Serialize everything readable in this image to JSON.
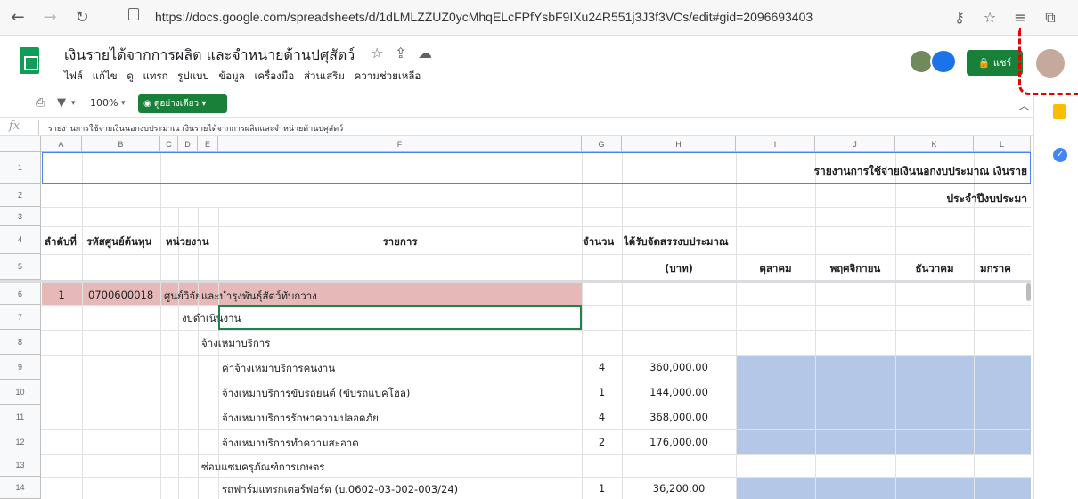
{
  "browser": {
    "url": "https://docs.google.com/spreadsheets/d/1dLMLZZUZ0ycMhqELcFPfYsbF9IXu24R551j3J3f3VCs/edit#gid=2096693403",
    "back_icon": "←",
    "forward_icon": "→",
    "reload_icon": "↻",
    "lock_icon": "🔒"
  },
  "doc": {
    "title": "เงินรายได้จากการผลิต และจำหน่ายด้านปศุสัตว์",
    "menu": [
      "ไฟล์",
      "แก้ไข",
      "ดู",
      "แทรก",
      "รูปแบบ",
      "ข้อมูล",
      "เครื่องมือ",
      "ส่วนเสริม",
      "ความช่วยเหลือ"
    ],
    "share_label": "แชร์"
  },
  "toolbar": {
    "zoom": "100%",
    "view_mode": "ดูอย่างเดียว"
  },
  "formula_bar": {
    "fx": "fx",
    "content": "รายงานการใช้จ่ายเงินนอกงบประมาณ เงินรายได้จากการผลิตและจำหน่ายด้านปศุสัตว์"
  },
  "columns": [
    "A",
    "B",
    "C",
    "D",
    "E",
    "F",
    "G",
    "H",
    "I",
    "J",
    "K",
    "L"
  ],
  "rows": [
    "1",
    "2",
    "3",
    "4",
    "5",
    "6",
    "7",
    "8",
    "9",
    "10",
    "11",
    "12",
    "13",
    "14"
  ],
  "sheet": {
    "r1_title": "รายงานการใช้จ่ายเงินนอกงบประมาณ เงินราย",
    "r2_subtitle": "ประจำปีงบประมา",
    "h_seq": "ลำดับที่",
    "h_cost_center": "รหัสศูนย์ต้นทุน",
    "h_unit": "หน่วยงาน",
    "h_item": "รายการ",
    "h_qty": "จำนวน",
    "h_budget": "ได้รับจัดสรรงบประมาณ",
    "h_baht": "(บาท)",
    "h_oct": "ตุลาคม",
    "h_nov": "พฤศจิกายน",
    "h_dec": "ธันวาคม",
    "h_jan": "มกราค",
    "r6_seq": "1",
    "r6_code": "0700600018",
    "r6_name": "ศูนย์วิจัยและบำรุงพันธุ์สัตว์ทับกวาง",
    "r7_text": "งบดำเนินงาน",
    "r8_text": "จ้างเหมาบริการ",
    "items": [
      {
        "name": "ค่าจ้างเหมาบริการคนงาน",
        "qty": "4",
        "amount": "360,000.00"
      },
      {
        "name": "จ้างเหมาบริการขับรถยนต์ (ขับรถแบคโฮล)",
        "qty": "1",
        "amount": "144,000.00"
      },
      {
        "name": "จ้างเหมาบริการรักษาความปลอดภัย",
        "qty": "4",
        "amount": "368,000.00"
      },
      {
        "name": "จ้างเหมาบริการทำความสะอาด",
        "qty": "2",
        "amount": "176,000.00"
      }
    ],
    "r13_text": "ซ่อมแซมครุภัณฑ์การเกษตร",
    "r14": {
      "name": "รถฟาร์มแทรกเตอร์ฟอร์ด (บ.0602-03-002-003/24)",
      "qty": "1",
      "amount": "36,200.00"
    }
  }
}
